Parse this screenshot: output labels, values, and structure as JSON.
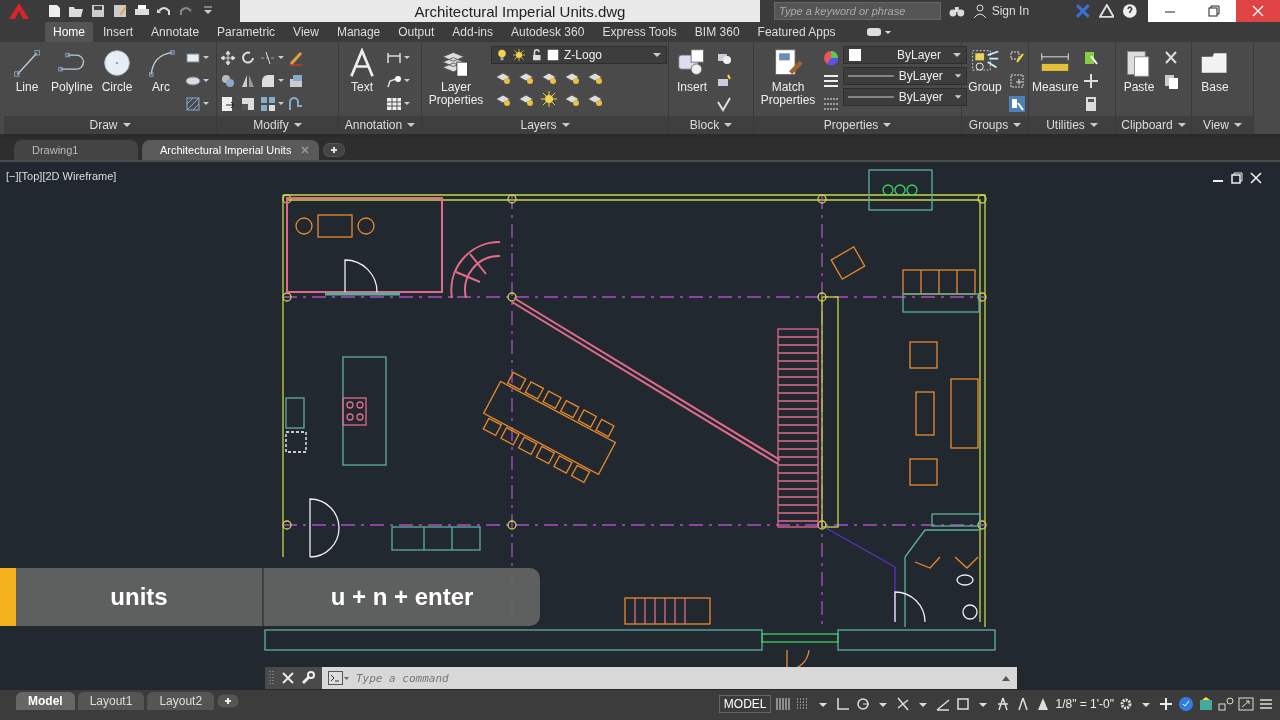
{
  "window": {
    "title": "Architectural Imperial Units.dwg"
  },
  "search": {
    "placeholder": "Type a keyword or phrase"
  },
  "account": {
    "label": "Sign In"
  },
  "ribbon_tabs": [
    {
      "label": "Home",
      "selected": true
    },
    {
      "label": "Insert",
      "selected": false
    },
    {
      "label": "Annotate",
      "selected": false
    },
    {
      "label": "Parametric",
      "selected": false
    },
    {
      "label": "View",
      "selected": false
    },
    {
      "label": "Manage",
      "selected": false
    },
    {
      "label": "Output",
      "selected": false
    },
    {
      "label": "Add-ins",
      "selected": false
    },
    {
      "label": "Autodesk 360",
      "selected": false
    },
    {
      "label": "Express Tools",
      "selected": false
    },
    {
      "label": "BIM 360",
      "selected": false
    },
    {
      "label": "Featured Apps",
      "selected": false
    }
  ],
  "panels": [
    {
      "title": "Draw",
      "kind": "draw",
      "tools": [
        {
          "label": "Line",
          "kind": "line"
        },
        {
          "label": "Polyline",
          "kind": "polyline"
        },
        {
          "label": "Circle",
          "kind": "circle"
        },
        {
          "label": "Arc",
          "kind": "arc"
        }
      ]
    },
    {
      "title": "Modify",
      "kind": "modify"
    },
    {
      "title": "Annotation",
      "kind": "annotation",
      "tools": [
        {
          "label": "Text",
          "kind": "text"
        }
      ]
    },
    {
      "title": "Layers",
      "kind": "layers",
      "tools": [
        {
          "label": "Layer Properties",
          "kind": "layers"
        }
      ],
      "layer": "Z-Logo"
    },
    {
      "title": "Block",
      "kind": "block",
      "tools": [
        {
          "label": "Insert",
          "kind": "insert"
        }
      ]
    },
    {
      "title": "Properties",
      "kind": "properties",
      "tools": [
        {
          "label": "Match Properties",
          "kind": "match"
        }
      ],
      "color_setting": "ByLayer",
      "linetype": "ByLayer",
      "lineweight": "ByLayer"
    },
    {
      "title": "Groups",
      "kind": "groups",
      "tools": [
        {
          "label": "Group",
          "kind": "group"
        }
      ]
    },
    {
      "title": "Utilities",
      "kind": "utilities",
      "tools": [
        {
          "label": "Measure",
          "kind": "measure"
        }
      ]
    },
    {
      "title": "Clipboard",
      "kind": "clipboard",
      "tools": [
        {
          "label": "Paste",
          "kind": "paste"
        }
      ]
    },
    {
      "title": "View",
      "kind": "view",
      "tools": [
        {
          "label": "Base",
          "kind": "base"
        }
      ]
    }
  ],
  "doc_tabs": [
    {
      "label": "Drawing1",
      "selected": false
    },
    {
      "label": "Architectural Imperial Units",
      "selected": true
    }
  ],
  "viewport": {
    "label": "[−][Top][2D Wireframe]"
  },
  "caption": {
    "command": "units",
    "keys": "u + n + enter"
  },
  "command_line": {
    "placeholder": "Type a command"
  },
  "layout_tabs": [
    {
      "label": "Model",
      "selected": true
    },
    {
      "label": "Layout1",
      "selected": false
    },
    {
      "label": "Layout2",
      "selected": false
    }
  ],
  "status_bar": {
    "mode": "MODEL",
    "scale": "1/8\" = 1'-0\""
  }
}
